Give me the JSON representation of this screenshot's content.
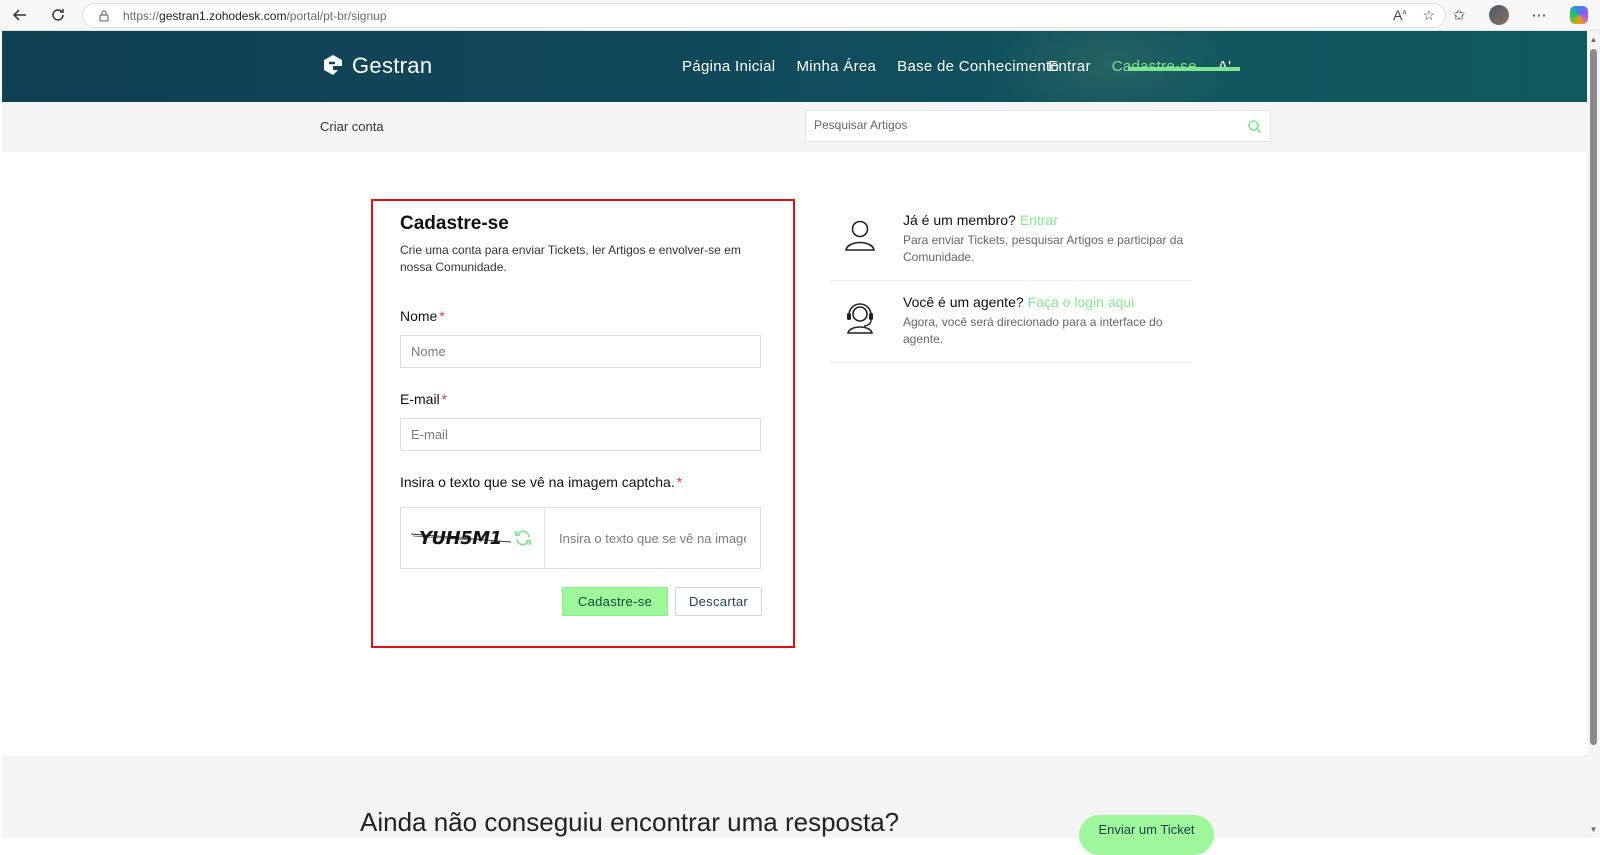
{
  "browser": {
    "url_prefix": "https://",
    "url_host": "gestran1.zohodesk.com",
    "url_path": "/portal/pt-br/signup"
  },
  "header": {
    "logo_text": "Gestran",
    "nav": [
      "Página Inicial",
      "Minha Área",
      "Base de Conhecimento",
      "Entrar",
      "Cadastre-se",
      "A'"
    ]
  },
  "subbar": {
    "breadcrumb": "Criar conta",
    "search_placeholder": "Pesquisar Artigos"
  },
  "form": {
    "title": "Cadastre-se",
    "description": "Crie uma conta para enviar Tickets, ler Artigos e envolver-se em nossa Comunidade.",
    "name_label": "Nome",
    "name_placeholder": "Nome",
    "email_label": "E-mail",
    "email_placeholder": "E-mail",
    "captcha_label": "Insira o texto que se vê na imagem captcha.",
    "required_mark": "*",
    "captcha_text": "YUH5M1",
    "captcha_placeholder": "Insira o texto que se vê na imagem captcha",
    "submit_label": "Cadastre-se",
    "discard_label": "Descartar"
  },
  "info": {
    "member_title": "Já é um membro?",
    "member_link": "Entrar",
    "member_desc": "Para enviar Tickets, pesquisar Artigos e participar da Comunidade.",
    "agent_title": "Você é um agente?",
    "agent_link": "Faça o login aqui",
    "agent_desc": "Agora, você será direcionado para a interface do agente."
  },
  "bottom": {
    "question": "Ainda não conseguiu encontrar uma resposta?",
    "ticket_button": "Enviar um Ticket"
  },
  "colors": {
    "header_bg": "#0f4454",
    "accent_green": "#7de58f",
    "button_green": "#9ef79b",
    "highlight_red": "#e10f14"
  }
}
